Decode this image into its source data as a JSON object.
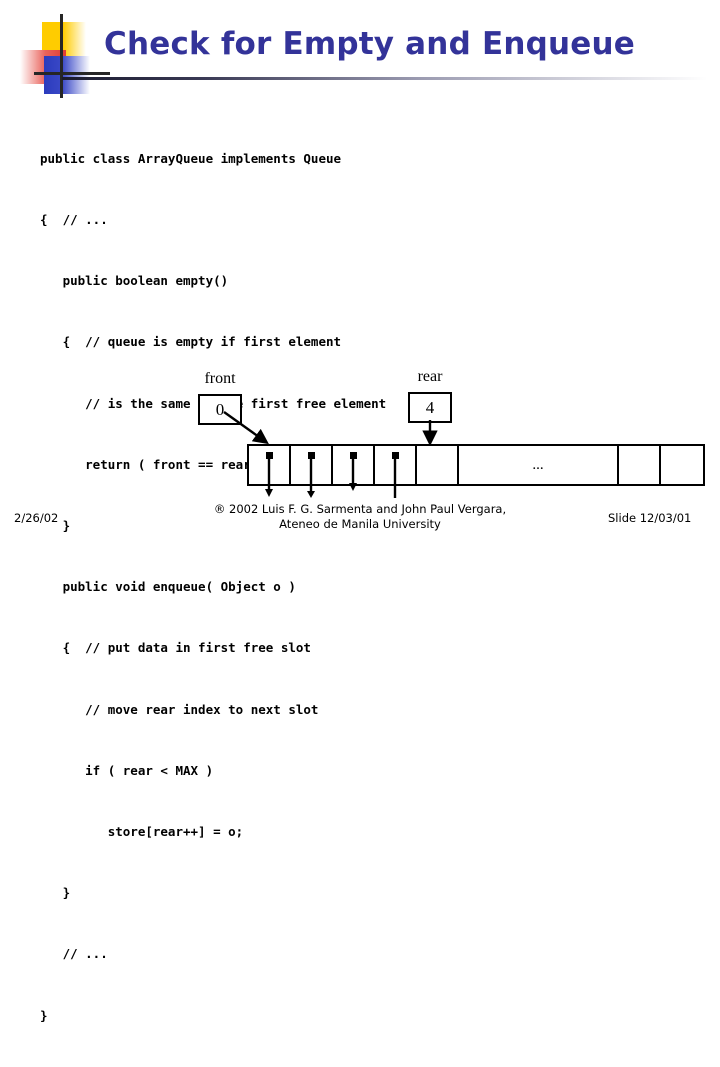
{
  "slide": {
    "title": "Check for Empty and Enqueue",
    "title_color": "#333399"
  },
  "logo": {
    "yellow": "#ffcc00",
    "red": "#e03b33",
    "blue": "#2b3bbd",
    "line": "#262626"
  },
  "code": {
    "lines": [
      "public class ArrayQueue implements Queue",
      "{  // ...",
      "   public boolean empty()",
      "   {  // queue is empty if first element",
      "      // is the same as the first free element",
      "      return ( front == rear );",
      "   }",
      "   public void enqueue( Object o )",
      "   {  // put data in first free slot",
      "      // move rear index to next slot",
      "      if ( rear < MAX )",
      "         store[rear++] = o;",
      "   }",
      "   // ...",
      "}"
    ]
  },
  "diagram": {
    "front": {
      "label": "front",
      "value": "0"
    },
    "rear": {
      "label": "rear",
      "value": "4"
    },
    "ellipsis": "...",
    "cells": [
      {
        "kind": "data",
        "width": "normal",
        "text": ""
      },
      {
        "kind": "data",
        "width": "normal",
        "text": ""
      },
      {
        "kind": "data",
        "width": "normal",
        "text": ""
      },
      {
        "kind": "data",
        "width": "normal",
        "text": ""
      },
      {
        "kind": "empty",
        "width": "normal",
        "text": ""
      },
      {
        "kind": "empty",
        "width": "wide",
        "text": "..."
      },
      {
        "kind": "empty",
        "width": "normal",
        "text": ""
      },
      {
        "kind": "empty",
        "width": "normal",
        "text": ""
      }
    ]
  },
  "footer": {
    "date": "2/26/02",
    "copyright_line1": "® 2002 Luis F. G. Sarmenta and John Paul Vergara,",
    "copyright_line2": "Ateneo de Manila University",
    "slide_number": "Slide 12/03/01"
  }
}
